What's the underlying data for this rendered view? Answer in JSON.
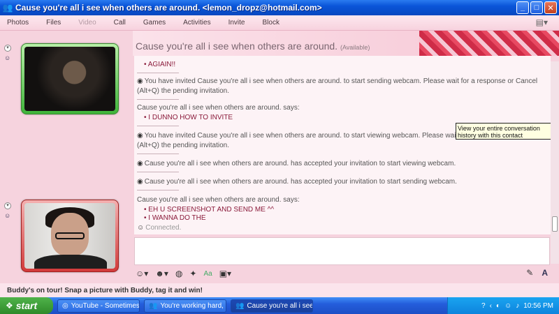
{
  "window": {
    "title": "Cause you're all i see when others are around. <lemon_dropz@hotmail.com>",
    "min_icon": "minimize-icon",
    "max_icon": "maximize-icon",
    "close_icon": "close-icon"
  },
  "menu": {
    "items": [
      {
        "label": "Photos",
        "enabled": true
      },
      {
        "label": "Files",
        "enabled": true
      },
      {
        "label": "Video",
        "enabled": false
      },
      {
        "label": "Call",
        "enabled": true
      },
      {
        "label": "Games",
        "enabled": true
      },
      {
        "label": "Activities",
        "enabled": true
      },
      {
        "label": "Invite",
        "enabled": true
      },
      {
        "label": "Block",
        "enabled": true
      }
    ]
  },
  "contact": {
    "name": "Cause you're all i see when others are around.",
    "status": "(Available)"
  },
  "messages": {
    "m1": "AGIAIN!!",
    "m2": "You have invited Cause you're all i see when others are around. to start sending webcam. Please wait for a response or Cancel (Alt+Q) the pending invitation.",
    "m3_said": "Cause you're all i see when others are around. says:",
    "m3": "I DUNNO HOW TO INVITE",
    "m4": "You have invited Cause you're all i see when others are around. to start viewing webcam. Please wait for a response or Cancel (Alt+Q) the pending invitation.",
    "m5": "Cause you're all i see when others are around. has accepted your invitation to start viewing webcam.",
    "m6": "Cause you're all i see when others are around. has accepted your invitation to start sending webcam.",
    "m7_said": "Cause you're all i see when others are around. says:",
    "m7a": "EH U SCREENSHOT AND SEND ME ^^",
    "m7b": "I WANNA DO THE",
    "connected": "Connected."
  },
  "tooltip": "View your entire conversation history with this contact",
  "promo": "Buddy's on tour! Snap a picture with Buddy, tag it and win!",
  "taskbar": {
    "start": "start",
    "tasks": [
      {
        "label": "YouTube - Sometimes...",
        "active": false
      },
      {
        "label": "You're working hard, ...",
        "active": false
      },
      {
        "label": "Cause you're all i see ...",
        "active": true
      }
    ],
    "clock": "10:56 PM"
  }
}
